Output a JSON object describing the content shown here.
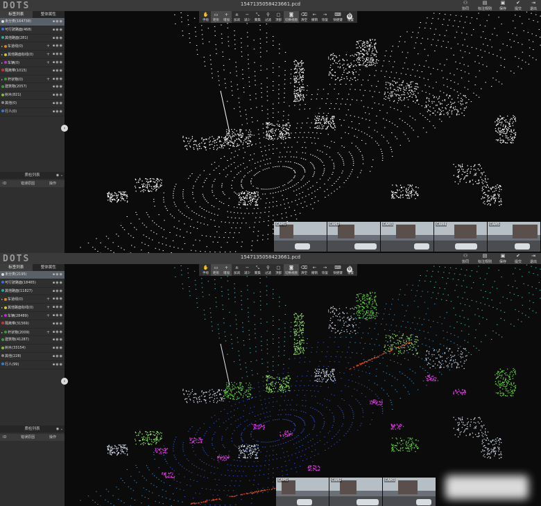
{
  "logo": "DOTS",
  "colors": {
    "label_list": [
      "#dddddd",
      "#3b6ed8",
      "#2aa6a6",
      "#d48a1c",
      "#c9c93a",
      "#b832c9",
      "#c9323a",
      "#2fa02f",
      "#3c9c3c",
      "#7bbf3a",
      "#8a8a8a",
      "#2f7fd8"
    ],
    "cloud_white": "#ffffff",
    "cloud_palette_ground": "#2f4fd8",
    "cloud_palette_car": "#d63ad8",
    "cloud_palette_veg": "#5fd83a",
    "cloud_palette_building": "#cfd8e8",
    "cloud_palette_barrier": "#e24a1a"
  },
  "panels": [
    {
      "filename": "1547135058423661.pcd",
      "sidebar_tabs": [
        {
          "label": "标签列表",
          "active": true
        },
        {
          "label": "整体属性",
          "active": false
        }
      ],
      "labels": [
        {
          "text": "未分类(164738)",
          "expand": false,
          "plus": false,
          "selected": true,
          "color_index": 0
        },
        {
          "text": "可行驶路面(468)",
          "expand": false,
          "plus": false,
          "selected": false,
          "color_index": 1
        },
        {
          "text": "其他路面(281)",
          "expand": false,
          "plus": false,
          "selected": false,
          "color_index": 2
        },
        {
          "text": "车道线(0)",
          "expand": true,
          "plus": true,
          "selected": false,
          "color_index": 3
        },
        {
          "text": "其他路面标线(0)",
          "expand": true,
          "plus": true,
          "selected": false,
          "color_index": 4
        },
        {
          "text": "车辆(0)",
          "expand": true,
          "plus": true,
          "selected": false,
          "color_index": 5
        },
        {
          "text": "隔离带(1015)",
          "expand": false,
          "plus": false,
          "selected": false,
          "color_index": 6
        },
        {
          "text": "杆状物(0)",
          "expand": true,
          "plus": true,
          "selected": false,
          "color_index": 7
        },
        {
          "text": "建筑物(2057)",
          "expand": false,
          "plus": false,
          "selected": false,
          "color_index": 8
        },
        {
          "text": "树木(821)",
          "expand": false,
          "plus": false,
          "selected": false,
          "color_index": 9
        },
        {
          "text": "其他(0)",
          "expand": false,
          "plus": false,
          "selected": false,
          "color_index": 10
        },
        {
          "text": "行人(0)",
          "expand": false,
          "plus": false,
          "selected": false,
          "color_index": 11
        }
      ],
      "colorized": false
    },
    {
      "filename": "1547135058423661.pcd",
      "sidebar_tabs": [
        {
          "label": "标签列表",
          "active": true
        },
        {
          "label": "整体属性",
          "active": false
        }
      ],
      "labels": [
        {
          "text": "未分类(2195)",
          "expand": false,
          "plus": false,
          "selected": true,
          "color_index": 0
        },
        {
          "text": "可行驶路面(18465)",
          "expand": false,
          "plus": false,
          "selected": false,
          "color_index": 1
        },
        {
          "text": "其他路面(11827)",
          "expand": false,
          "plus": false,
          "selected": false,
          "color_index": 2
        },
        {
          "text": "车道线(0)",
          "expand": true,
          "plus": true,
          "selected": false,
          "color_index": 3
        },
        {
          "text": "其他路面标线(0)",
          "expand": true,
          "plus": true,
          "selected": false,
          "color_index": 4
        },
        {
          "text": "车辆(28489)",
          "expand": true,
          "plus": true,
          "selected": false,
          "color_index": 5
        },
        {
          "text": "隔离带(31569)",
          "expand": false,
          "plus": false,
          "selected": false,
          "color_index": 6
        },
        {
          "text": "杆状物(2009)",
          "expand": true,
          "plus": true,
          "selected": false,
          "color_index": 7
        },
        {
          "text": "建筑物(41287)",
          "expand": false,
          "plus": false,
          "selected": false,
          "color_index": 8
        },
        {
          "text": "树木(33154)",
          "expand": false,
          "plus": false,
          "selected": false,
          "color_index": 9
        },
        {
          "text": "其他(228)",
          "expand": false,
          "plus": false,
          "selected": false,
          "color_index": 10
        },
        {
          "text": "行人(99)",
          "expand": false,
          "plus": false,
          "selected": false,
          "color_index": 11
        }
      ],
      "colorized": true
    }
  ],
  "qc_panel": {
    "title": "质检列表",
    "columns": [
      "ID",
      "错误原因",
      "操作"
    ]
  },
  "toolbar": [
    {
      "label": "手绘",
      "icon": "hand-icon",
      "glyph": "✋",
      "active": false
    },
    {
      "label": "矩形",
      "icon": "rectangle-icon",
      "glyph": "▭",
      "active": true
    },
    {
      "label": "增加",
      "icon": "plus-icon",
      "glyph": "+",
      "active": true
    },
    {
      "label": "加减",
      "icon": "plus-minus-icon",
      "glyph": "±",
      "active": false
    },
    {
      "label": "减少",
      "icon": "minus-icon",
      "glyph": "−",
      "active": false
    },
    {
      "label": "聚集",
      "icon": "focus-icon",
      "glyph": "⤡",
      "active": false
    },
    {
      "label": "过滤",
      "icon": "filter-icon",
      "glyph": "⚲",
      "active": false
    },
    {
      "label": "顶部",
      "icon": "top-view-icon",
      "glyph": "▢",
      "active": false
    },
    {
      "label": "切换视图",
      "icon": "camera-icon",
      "glyph": "◙",
      "active": true,
      "wide": true
    },
    {
      "label": "清空",
      "icon": "clear-icon",
      "glyph": "⌫",
      "active": false
    },
    {
      "label": "撤销",
      "icon": "undo-icon",
      "glyph": "←",
      "active": false
    },
    {
      "label": "恢复",
      "icon": "redo-icon",
      "glyph": "→",
      "active": false
    },
    {
      "label": "快捷键",
      "icon": "keyboard-icon",
      "glyph": "⌨",
      "active": false,
      "wide": true
    },
    {
      "label": "设置",
      "icon": "settings-icon",
      "glyph": "✎",
      "active": false
    }
  ],
  "right_tools": [
    {
      "label": "协同",
      "icon": "collaborate-icon",
      "glyph": "⚇"
    },
    {
      "label": "标注规则",
      "icon": "rules-icon",
      "glyph": "▤",
      "wide": true
    },
    {
      "label": "保存",
      "icon": "save-icon",
      "glyph": "▣"
    },
    {
      "label": "提交",
      "icon": "submit-icon",
      "glyph": "✔"
    },
    {
      "label": "退出",
      "icon": "exit-icon",
      "glyph": "⇥"
    }
  ],
  "cameras": [
    "CAM1",
    "CAM2",
    "CAM3",
    "CAM4",
    "CAM5"
  ]
}
